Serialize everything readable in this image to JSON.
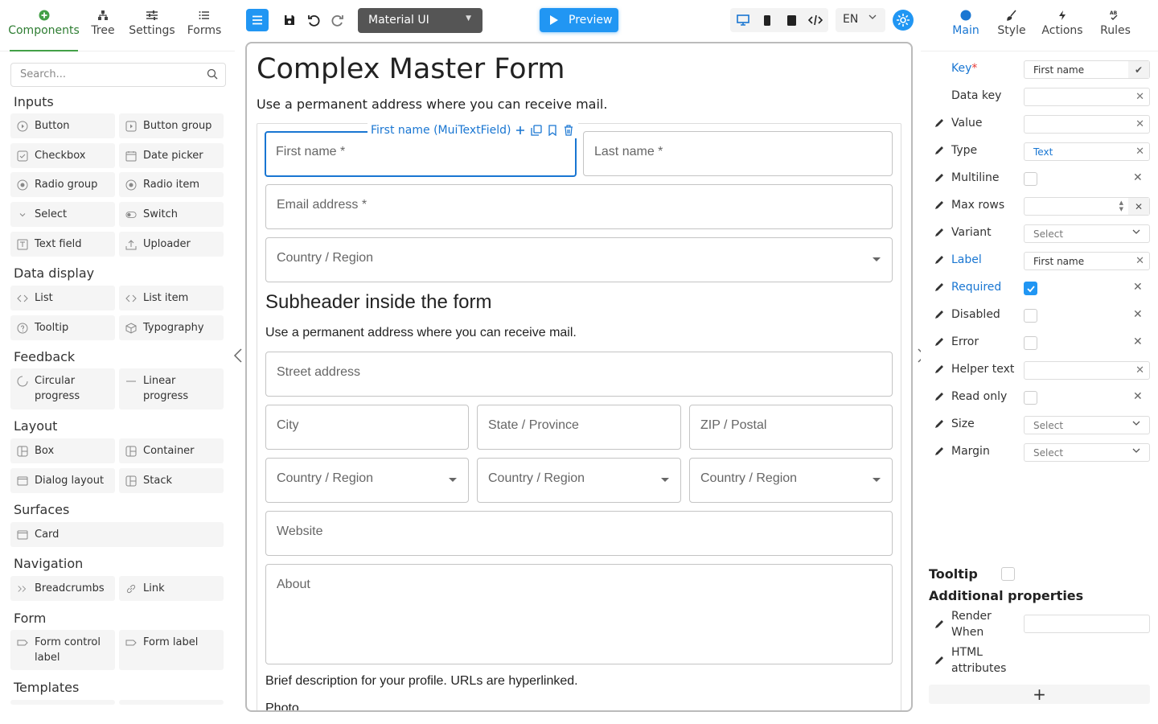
{
  "left_panel": {
    "tabs": [
      {
        "label": "Components",
        "icon": "plus-circle-icon",
        "active": true
      },
      {
        "label": "Tree",
        "icon": "tree-icon"
      },
      {
        "label": "Settings",
        "icon": "sliders-icon"
      },
      {
        "label": "Forms",
        "icon": "list-icon"
      }
    ],
    "search_placeholder": "Search...",
    "groups": [
      {
        "title": "Inputs",
        "items": [
          "Button",
          "Button group",
          "Checkbox",
          "Date picker",
          "Radio group",
          "Radio item",
          "Select",
          "Switch",
          "Text field",
          "Uploader"
        ]
      },
      {
        "title": "Data display",
        "items": [
          "List",
          "List item",
          "Tooltip",
          "Typography"
        ]
      },
      {
        "title": "Feedback",
        "items": [
          "Circular progress",
          "Linear progress"
        ]
      },
      {
        "title": "Layout",
        "items": [
          "Box",
          "Container",
          "Dialog layout",
          "Stack"
        ]
      },
      {
        "title": "Surfaces",
        "items": [
          "Card"
        ]
      },
      {
        "title": "Navigation",
        "items": [
          "Breadcrumbs",
          "Link"
        ]
      },
      {
        "title": "Form",
        "items": [
          "Form control label",
          "Form label"
        ]
      },
      {
        "title": "Templates",
        "items": []
      }
    ]
  },
  "toolbar": {
    "theme_select_value": "Material UI",
    "preview_label": "Preview",
    "language": "EN"
  },
  "form": {
    "title": "Complex Master Form",
    "subtitle": "Use a permanent address where you can receive mail.",
    "selected_label": "First name (MuiTextField)",
    "fields": {
      "first_name": "First name *",
      "last_name": "Last name *",
      "email": "Email address *",
      "country": "Country / Region",
      "street": "Street address",
      "city": "City",
      "state": "State / Province",
      "zip": "ZIP / Postal",
      "country2": "Country / Region",
      "country3": "Country / Region",
      "country4": "Country / Region",
      "website": "Website",
      "about": "About"
    },
    "subheader": "Subheader inside the form",
    "subheader_text": "Use a permanent address where you can receive mail.",
    "helper_text": "Brief description for your profile. URLs are hyperlinked.",
    "photo_label": "Photo"
  },
  "right_panel": {
    "tabs": [
      {
        "label": "Main",
        "icon": "circle-icon",
        "active": true
      },
      {
        "label": "Style",
        "icon": "brush-icon"
      },
      {
        "label": "Actions",
        "icon": "bolt-icon"
      },
      {
        "label": "Rules",
        "icon": "rules-icon"
      }
    ],
    "props": {
      "key": {
        "label": "Key",
        "required_mark": "*",
        "value": "First name"
      },
      "data_key": {
        "label": "Data key",
        "value": ""
      },
      "value": {
        "label": "Value",
        "value": ""
      },
      "type": {
        "label": "Type",
        "value": "Text"
      },
      "multiline": {
        "label": "Multiline",
        "checked": false
      },
      "max_rows": {
        "label": "Max rows",
        "value": ""
      },
      "variant": {
        "label": "Variant",
        "value": "Select"
      },
      "label": {
        "label": "Label",
        "value": "First name"
      },
      "required": {
        "label": "Required",
        "checked": true
      },
      "disabled": {
        "label": "Disabled",
        "checked": false
      },
      "error": {
        "label": "Error",
        "checked": false
      },
      "helper_text": {
        "label": "Helper text",
        "value": ""
      },
      "read_only": {
        "label": "Read only",
        "checked": false
      },
      "size": {
        "label": "Size",
        "value": "Select"
      },
      "margin": {
        "label": "Margin",
        "value": "Select"
      }
    },
    "tooltip_label": "Tooltip",
    "additional_title": "Additional properties",
    "render_when_label": "Render When",
    "html_attributes_label": "HTML attributes",
    "add_symbol": "+"
  },
  "colors": {
    "accent": "#2196f3",
    "components_tab": "#2e7d32",
    "selection": "#1976d2",
    "required_mark": "#e53935"
  }
}
